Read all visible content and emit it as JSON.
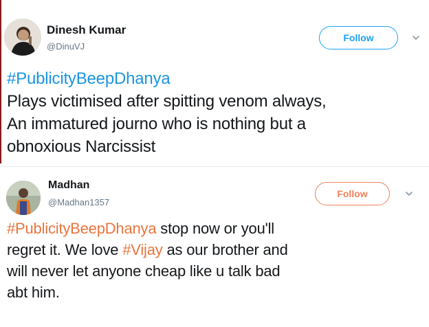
{
  "tweets": [
    {
      "user": {
        "name": "Dinesh Kumar",
        "handle": "@DinuVJ"
      },
      "follow_label": "Follow",
      "accent": "#1da1f2",
      "line1_tag": "#PublicityBeepDhanya",
      "line2": "Plays victimised after spitting venom always,",
      "line3": "An immatured journo who is nothing but a",
      "line4": "obnoxious Narcissist"
    },
    {
      "user": {
        "name": "Madhan",
        "handle": "@Madhan1357"
      },
      "follow_label": "Follow",
      "accent": "#f0805a",
      "line1_tag": "#PublicityBeepDhanya",
      "line1_rest": " stop now or you'll",
      "line2_pre": "regret it. We love ",
      "line2_tag": "#Vijay",
      "line2_post": " as our brother and",
      "line3": "will never let anyone cheap like u talk bad",
      "line4": "abt him."
    }
  ],
  "icons": {
    "avatar": "avatar-icon",
    "more": "chevron-down-icon"
  }
}
